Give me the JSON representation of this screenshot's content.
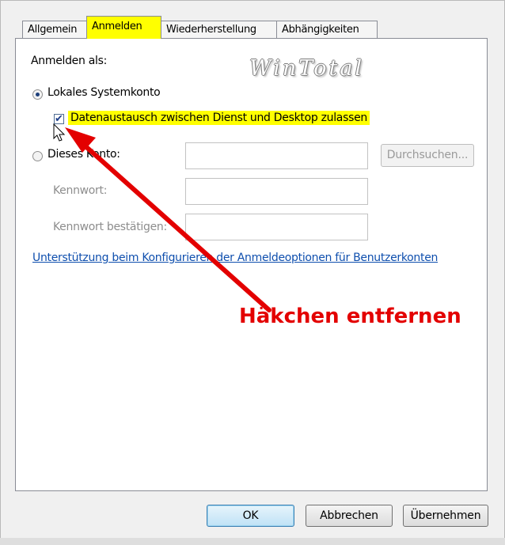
{
  "tabs": [
    {
      "label": "Allgemein",
      "active": false
    },
    {
      "label": "Anmelden",
      "active": true
    },
    {
      "label": "Wiederherstellung",
      "active": false
    },
    {
      "label": "Abhängigkeiten",
      "active": false
    }
  ],
  "logon": {
    "heading": "Anmelden als:",
    "watermark": "WinTotal",
    "local_system_label": "Lokales Systemkonto",
    "allow_interaction_label": "Datenaustausch zwischen Dienst und Desktop zulassen",
    "allow_interaction_checked": true,
    "this_account_label": "Dieses Konto:",
    "this_account_value": "",
    "browse_label": "Durchsuchen...",
    "password_label": "Kennwort:",
    "password_value": "",
    "confirm_password_label": "Kennwort bestätigen:",
    "confirm_password_value": "",
    "help_link": "Unterstützung beim Konfigurieren der Anmeldeoptionen für Benutzerkonten"
  },
  "annotation": {
    "text": "Häkchen entfernen",
    "color": "#e30000"
  },
  "buttons": {
    "ok": "OK",
    "cancel": "Abbrechen",
    "apply": "Übernehmen"
  },
  "colors": {
    "highlight": "#ffff00",
    "link": "#0f4fae",
    "annotation_red": "#e30000"
  }
}
